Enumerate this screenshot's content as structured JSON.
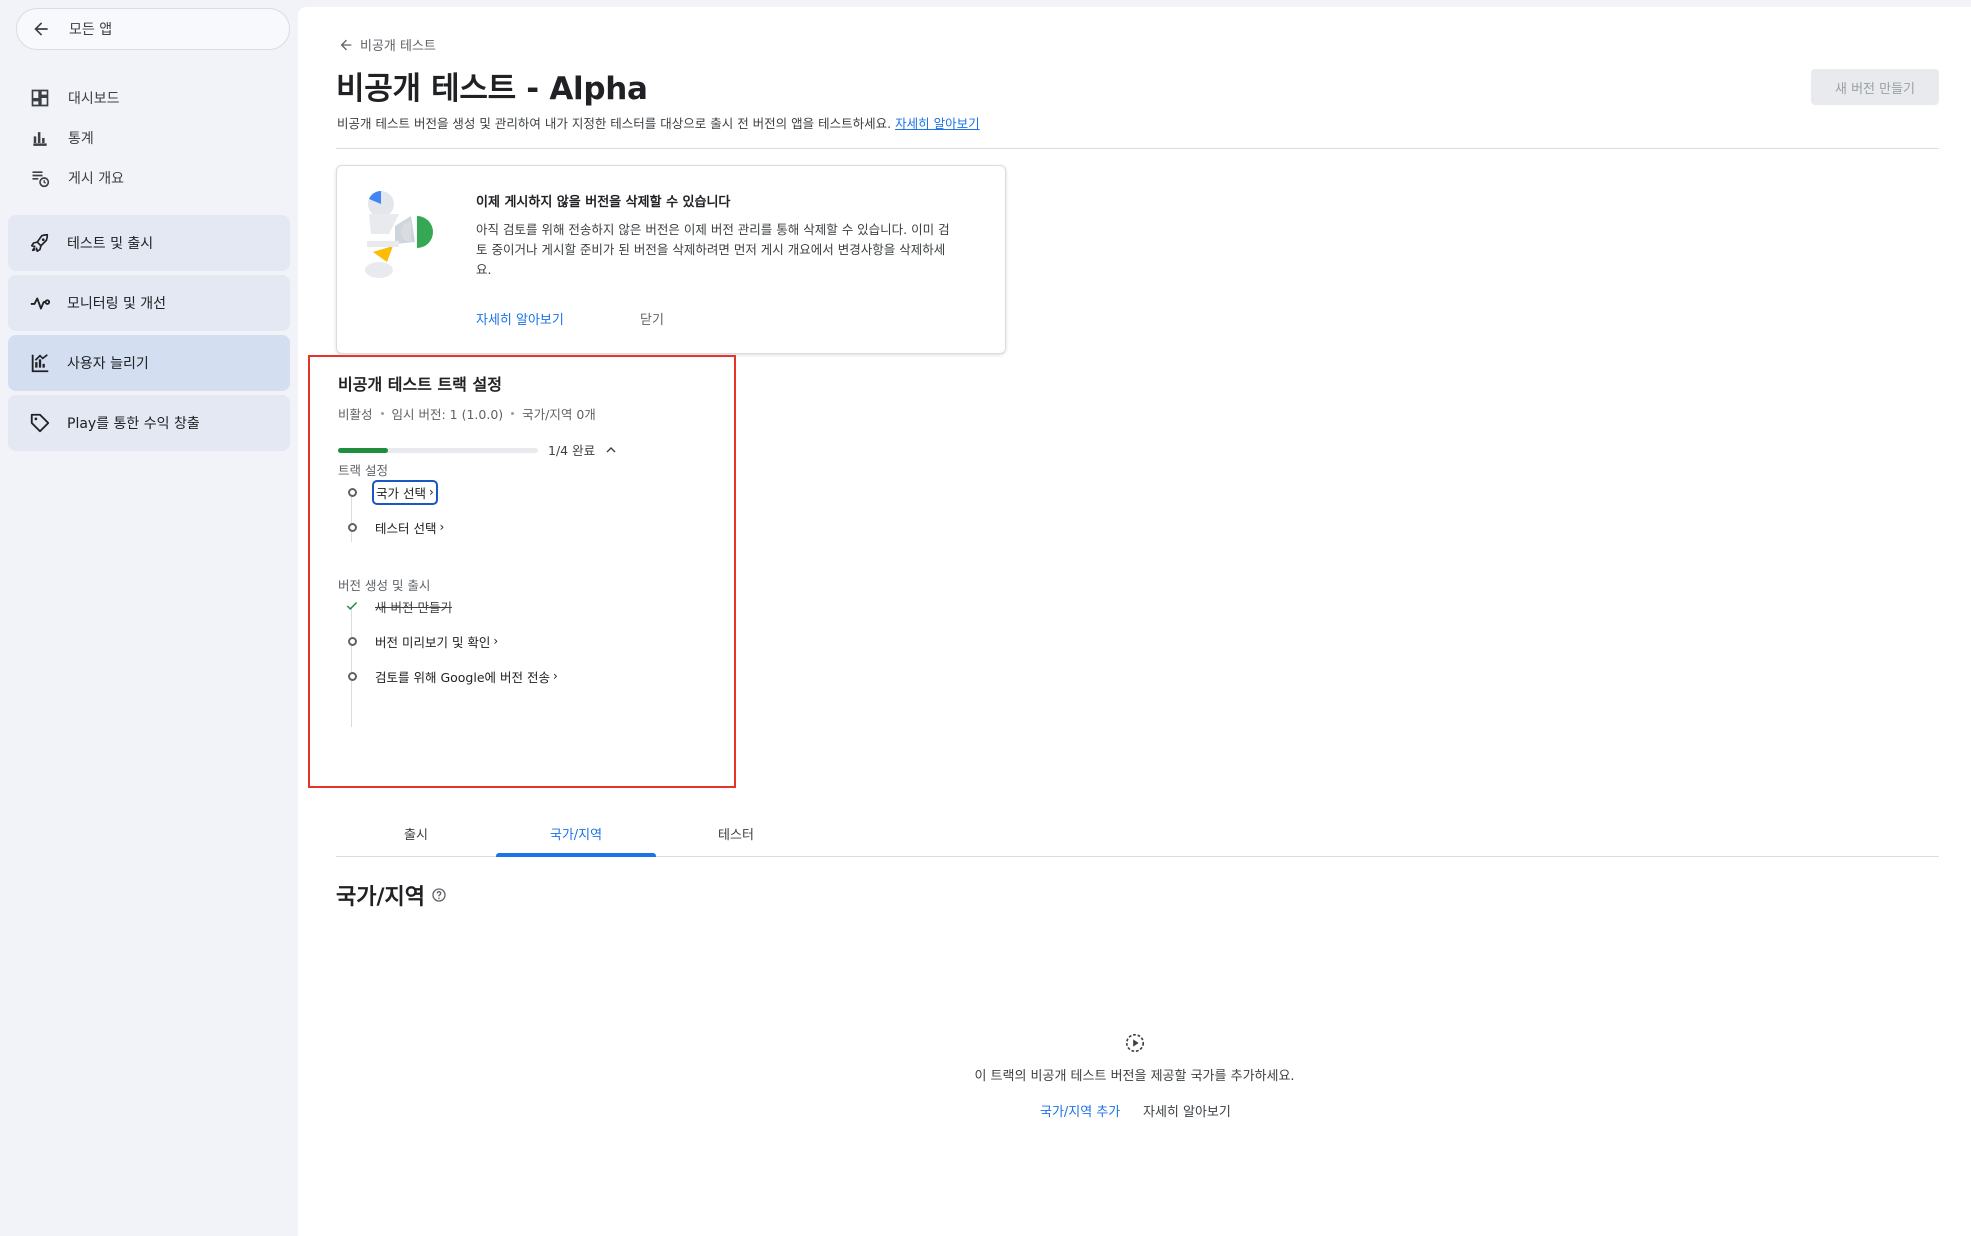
{
  "sidebar": {
    "back_label": "모든 앱",
    "plain_items": [
      {
        "label": "대시보드",
        "icon": "dashboard-icon"
      },
      {
        "label": "통계",
        "icon": "bar-chart-icon"
      },
      {
        "label": "게시 개요",
        "icon": "publishing-overview-icon"
      }
    ],
    "card_items": [
      {
        "label": "테스트 및 출시",
        "icon": "rocket-icon",
        "active": false
      },
      {
        "label": "모니터링 및 개선",
        "icon": "vitals-icon",
        "active": false
      },
      {
        "label": "사용자 늘리기",
        "icon": "grow-users-icon",
        "active": true
      },
      {
        "label": "Play를 통한 수익 창출",
        "icon": "tag-icon",
        "active": false
      }
    ]
  },
  "header": {
    "breadcrumb": "비공개 테스트",
    "title": "비공개 테스트 - Alpha",
    "description": "비공개 테스트 버전을 생성 및 관리하여 내가 지정한 테스터를 대상으로 출시 전 버전의 앱을 테스트하세요.",
    "learn_more": "자세히 알아보기",
    "new_release_button": "새 버전 만들기"
  },
  "notice": {
    "title": "이제 게시하지 않을 버전을 삭제할 수 있습니다",
    "body": "아직 검토를 위해 전송하지 않은 버전은 이제 버전 관리를 통해 삭제할 수 있습니다. 이미 검토 중이거나 게시할 준비가 된 버전을 삭제하려면 먼저 게시 개요에서 변경사항을 삭제하세요.",
    "learn_more": "자세히 알아보기",
    "close": "닫기"
  },
  "track_setup": {
    "title": "비공개 테스트 트랙 설정",
    "status": "비활성",
    "draft": "임시 버전: 1 (1.0.0)",
    "countries": "국가/지역 0개",
    "progress_fraction": 0.25,
    "progress_label": "1/4 완료",
    "sections": [
      {
        "label": "트랙 설정",
        "steps": [
          {
            "label": "국가 선택",
            "done": false
          },
          {
            "label": "테스터 선택",
            "done": false
          }
        ]
      },
      {
        "label": "버전 생성 및 출시",
        "steps": [
          {
            "label": "새 버전 만들기",
            "done": true
          },
          {
            "label": "버전 미리보기 및 확인",
            "done": false
          },
          {
            "label": "검토를 위해 Google에 버전 전송",
            "done": false
          }
        ]
      }
    ]
  },
  "tabs": [
    {
      "label": "출시",
      "active": false
    },
    {
      "label": "국가/지역",
      "active": true
    },
    {
      "label": "테스터",
      "active": false
    }
  ],
  "countries_section": {
    "heading": "국가/지역",
    "empty_text": "이 트랙의 비공개 테스트 버전을 제공할 국가를 추가하세요.",
    "add_link": "국가/지역 추가",
    "learn_more": "자세히 알아보기"
  },
  "colors": {
    "accent": "#1a73e8",
    "progress": "#1e8e3e",
    "highlight_box": "#e53528"
  }
}
